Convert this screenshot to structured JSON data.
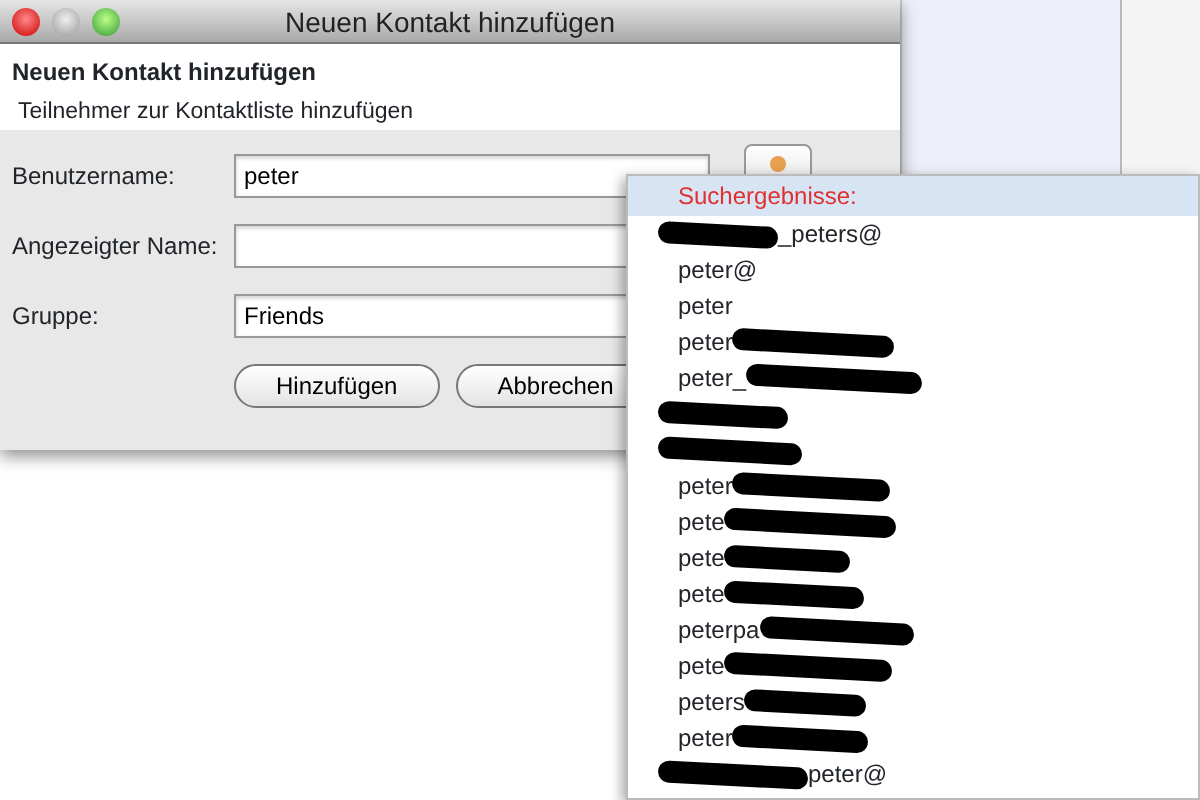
{
  "window": {
    "title": "Neuen Kontakt hinzufügen"
  },
  "header": {
    "title": "Neuen Kontakt hinzufügen",
    "subtitle": "Teilnehmer zur Kontaktliste hinzufügen"
  },
  "form": [
    {
      "label": "Benutzername:",
      "value": "peter"
    },
    {
      "label": "Angezeigter Name:"
    },
    {
      "label": "Gruppe:",
      "value": "Friends"
    }
  ],
  "buttons": [
    "Hinzufügen",
    "Abbrechen"
  ],
  "search_results": {
    "title": "Suchergebnisse:",
    "items": [
      {
        "redacted": true,
        "after": "_peters@"
      },
      {
        "before": "peter@",
        "redacted": false
      },
      {
        "before": "peter",
        "redacted": false
      },
      {
        "before": "peter",
        "redacted": true
      },
      {
        "before": "peter_",
        "redacted": true
      },
      {
        "redacted": true
      },
      {
        "redacted": true
      },
      {
        "before": "peter",
        "redacted": true
      },
      {
        "before": "pete",
        "redacted": true
      },
      {
        "before": "pete",
        "redacted": true
      },
      {
        "before": "pete",
        "redacted": true
      },
      {
        "before": "peterpa",
        "redacted": true
      },
      {
        "before": "pete",
        "redacted": true
      },
      {
        "before": "peters",
        "redacted": true
      },
      {
        "before": "peter",
        "redacted": true
      },
      {
        "redacted": true,
        "after": "peter@"
      }
    ]
  }
}
